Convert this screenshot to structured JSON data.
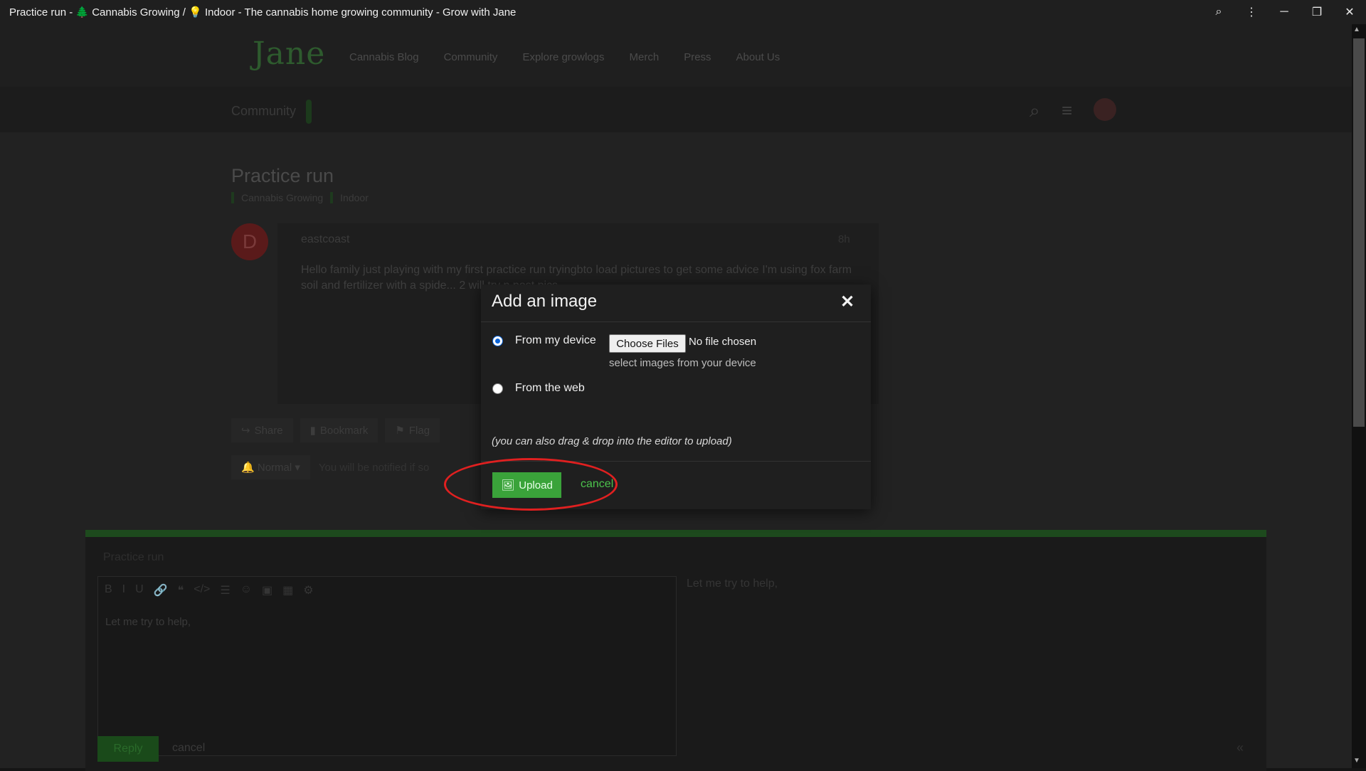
{
  "window": {
    "title": "Practice run - 🌲 Cannabis Growing / 💡 Indoor - The cannabis home growing community - Grow with Jane",
    "controls": {
      "zoom": "⌕",
      "menu": "⋮",
      "minimize": "─",
      "maximize": "❐",
      "close": "✕"
    }
  },
  "site": {
    "logo_text": "Jane",
    "nav": [
      "Cannabis Blog",
      "Community",
      "Explore growlogs",
      "Merch",
      "Press",
      "About Us"
    ],
    "community_label": "Community"
  },
  "topic": {
    "title": "Practice run",
    "category": "Cannabis Growing",
    "subcategory": "Indoor"
  },
  "post": {
    "avatar_letter": "D",
    "username": "eastcoast",
    "age": "8h",
    "body": "Hello family just playing with my first practice run tryingbto load pictures to get some advice I'm using fox farm soil and fertilizer with a spide... 2 will try n post pics"
  },
  "actions": [
    "Share",
    "Bookmark",
    "Flag"
  ],
  "notification": {
    "level": "Normal",
    "text": "You will be notified if so"
  },
  "composer": {
    "topic": "Practice run",
    "editor_text": "Let me try to help,",
    "preview_text": "Let me try to help,",
    "reply_label": "Reply",
    "cancel_label": "cancel"
  },
  "modal": {
    "title": "Add an image",
    "option_device": "From my device",
    "option_web": "From the web",
    "file_button": "Choose Files",
    "file_status": "No file chosen",
    "file_hint": "select images from your device",
    "dnd_hint": "(you can also drag & drop into the editor to upload)",
    "upload_label": "Upload",
    "cancel_label": "cancel",
    "selected_option": "device"
  },
  "colors": {
    "accent": "#3aa33a",
    "annotation": "#e02020"
  }
}
